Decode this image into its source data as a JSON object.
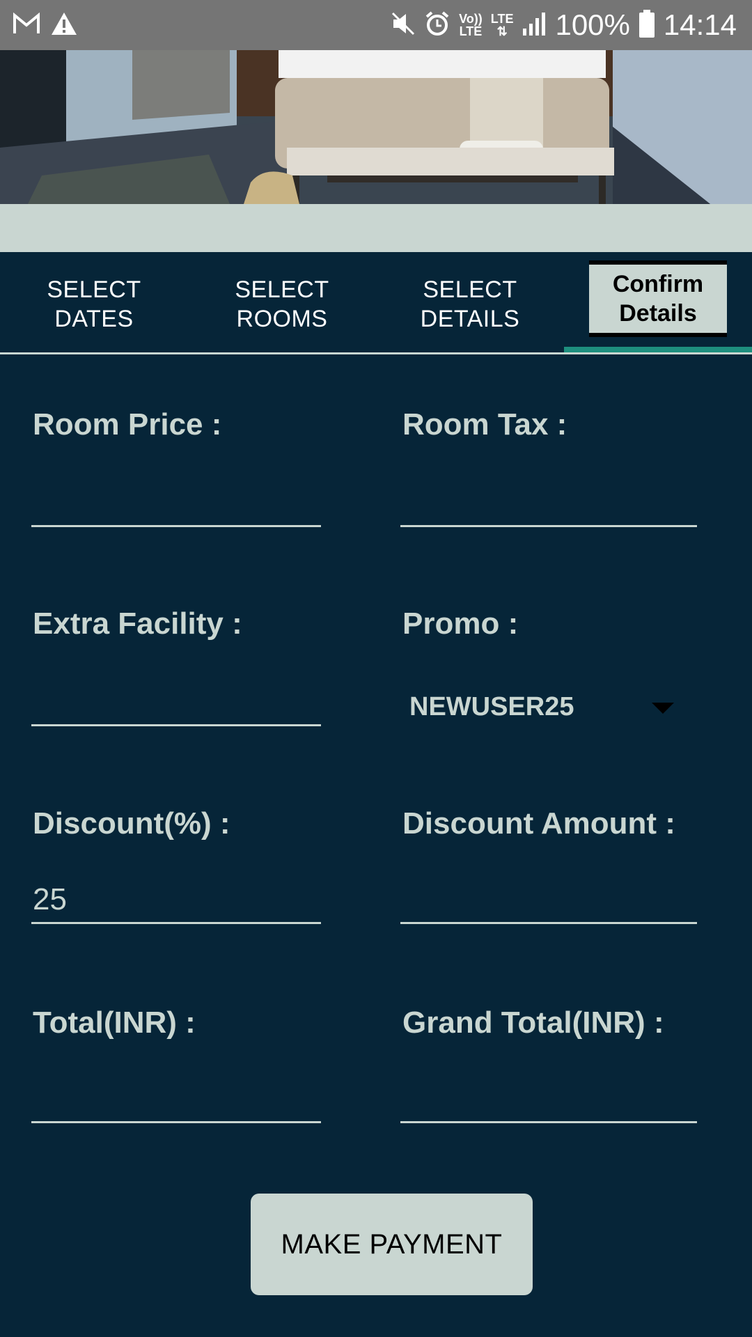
{
  "status_bar": {
    "lte_top": "Vo))",
    "lte_bottom": "LTE",
    "lte2": "LTE",
    "battery": "100%",
    "time": "14:14"
  },
  "tabs": [
    {
      "label_line1": "SELECT",
      "label_line2": "DATES"
    },
    {
      "label_line1": "SELECT",
      "label_line2": "ROOMS"
    },
    {
      "label_line1": "SELECT",
      "label_line2": "DETAILS"
    },
    {
      "label_line1": "Confirm",
      "label_line2": "Details"
    }
  ],
  "form": {
    "room_price": {
      "label": "Room Price :",
      "value": ""
    },
    "room_tax": {
      "label": "Room Tax :",
      "value": ""
    },
    "extra_facility": {
      "label": "Extra Facility :",
      "value": ""
    },
    "promo": {
      "label": "Promo :",
      "selected": "NEWUSER25"
    },
    "discount_percent": {
      "label": "Discount(%) :",
      "value": "25"
    },
    "discount_amount": {
      "label": "Discount Amount :",
      "value": ""
    },
    "total": {
      "label": "Total(INR) :",
      "value": ""
    },
    "grand_total": {
      "label": "Grand Total(INR) :",
      "value": ""
    }
  },
  "make_payment_label": "MAKE PAYMENT",
  "colors": {
    "background": "#062538",
    "accent": "#c9d6d1",
    "status_bar": "#757575",
    "tab_indicator": "#1e8f7e"
  }
}
